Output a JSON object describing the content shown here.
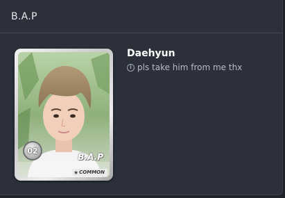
{
  "header": {
    "title": "B.A.P"
  },
  "card": {
    "number": "02",
    "group_logo": "B.A.P",
    "rarity": "COMMON",
    "rarity_icon": "star-icon"
  },
  "member": {
    "name": "Daehyun",
    "description": "pls take him from me thx",
    "info_icon": "info-icon"
  }
}
